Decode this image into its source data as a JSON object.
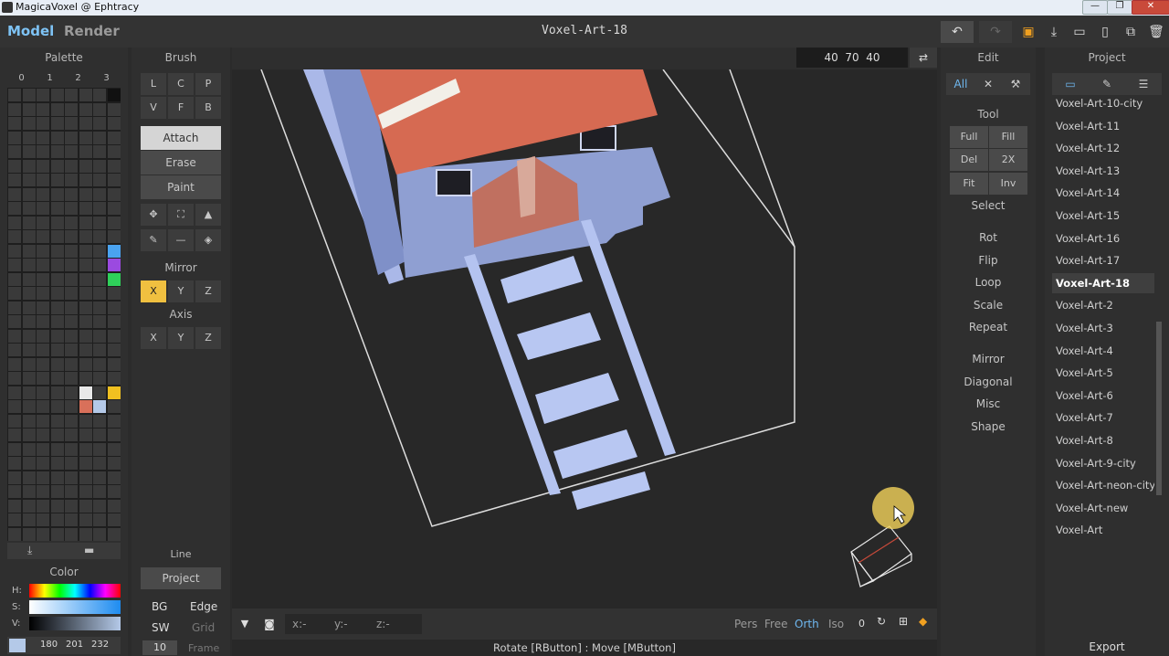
{
  "window": {
    "title": "MagicaVoxel @ Ephtracy",
    "min": "—",
    "max": "❐",
    "close": "✕"
  },
  "header": {
    "tabs": [
      {
        "label": "Model"
      },
      {
        "label": "Render"
      }
    ],
    "doc_title": "Voxel-Art-18",
    "icons": [
      "undo-icon",
      "redo-icon",
      "save-icon",
      "export-icon",
      "open-icon",
      "new-icon",
      "copy-icon",
      "delete-icon"
    ]
  },
  "palette": {
    "title": "Palette",
    "pages": [
      "0",
      "1",
      "2",
      "3"
    ],
    "colored_cells": [
      {
        "col": 7,
        "row": 0,
        "color": "#111111"
      },
      {
        "col": 7,
        "row": 11,
        "color": "#4aa3f0"
      },
      {
        "col": 7,
        "row": 12,
        "color": "#9b4ae0"
      },
      {
        "col": 7,
        "row": 13,
        "color": "#2fd05a"
      },
      {
        "col": 5,
        "row": 21,
        "color": "#e8e8e8"
      },
      {
        "col": 7,
        "row": 21,
        "color": "#f0c020"
      },
      {
        "col": 5,
        "row": 22,
        "color": "#d9705a"
      },
      {
        "col": 6,
        "row": 22,
        "color": "#b4c9e8"
      }
    ]
  },
  "color": {
    "title": "Color",
    "h_label": "H:",
    "s_label": "S:",
    "v_label": "V:",
    "r": "180",
    "g": "201",
    "b": "232",
    "swatch": "#b4c9e8"
  },
  "brush": {
    "title": "Brush",
    "types": [
      "L",
      "C",
      "P",
      "V",
      "F",
      "B"
    ],
    "modes": [
      "Attach",
      "Erase",
      "Paint"
    ],
    "active_mode": "Attach",
    "mirror_title": "Mirror",
    "mirror": [
      "X",
      "Y",
      "Z"
    ],
    "mirror_active": "X",
    "axis_title": "Axis",
    "axis": [
      "X",
      "Y",
      "Z"
    ],
    "line_label": "Line",
    "project_btn": "Project",
    "bg": "BG",
    "edge": "Edge",
    "sw": "SW",
    "grid": "Grid",
    "frame_value": "10",
    "frame": "Frame"
  },
  "viewport": {
    "size": "40  70  40",
    "coords": {
      "x": "x:-",
      "y": "y:-",
      "z": "z:-"
    },
    "views": [
      "Pers",
      "Free",
      "Orth",
      "Iso"
    ],
    "active_view": "Orth",
    "zoom": "0",
    "status": "Rotate [RButton] : Move [MButton]"
  },
  "edit": {
    "title": "Edit",
    "tabs": [
      "All"
    ],
    "tool_title": "Tool",
    "tools": [
      "Full",
      "Fill",
      "Del",
      "2X",
      "Fit",
      "Inv"
    ],
    "select": "Select",
    "ops": [
      "Rot",
      "Flip",
      "Loop",
      "Scale",
      "Repeat"
    ],
    "extra": [
      "Mirror",
      "Diagonal",
      "Misc",
      "Shape"
    ]
  },
  "project": {
    "title": "Project",
    "items": [
      "Voxel-Art-10-city",
      "Voxel-Art-11",
      "Voxel-Art-12",
      "Voxel-Art-13",
      "Voxel-Art-14",
      "Voxel-Art-15",
      "Voxel-Art-16",
      "Voxel-Art-17",
      "Voxel-Art-18",
      "Voxel-Art-2",
      "Voxel-Art-3",
      "Voxel-Art-4",
      "Voxel-Art-5",
      "Voxel-Art-6",
      "Voxel-Art-7",
      "Voxel-Art-8",
      "Voxel-Art-9-city",
      "Voxel-Art-neon-city",
      "Voxel-Art-new",
      "Voxel-Art"
    ],
    "selected": "Voxel-Art-18",
    "export": "Export"
  }
}
